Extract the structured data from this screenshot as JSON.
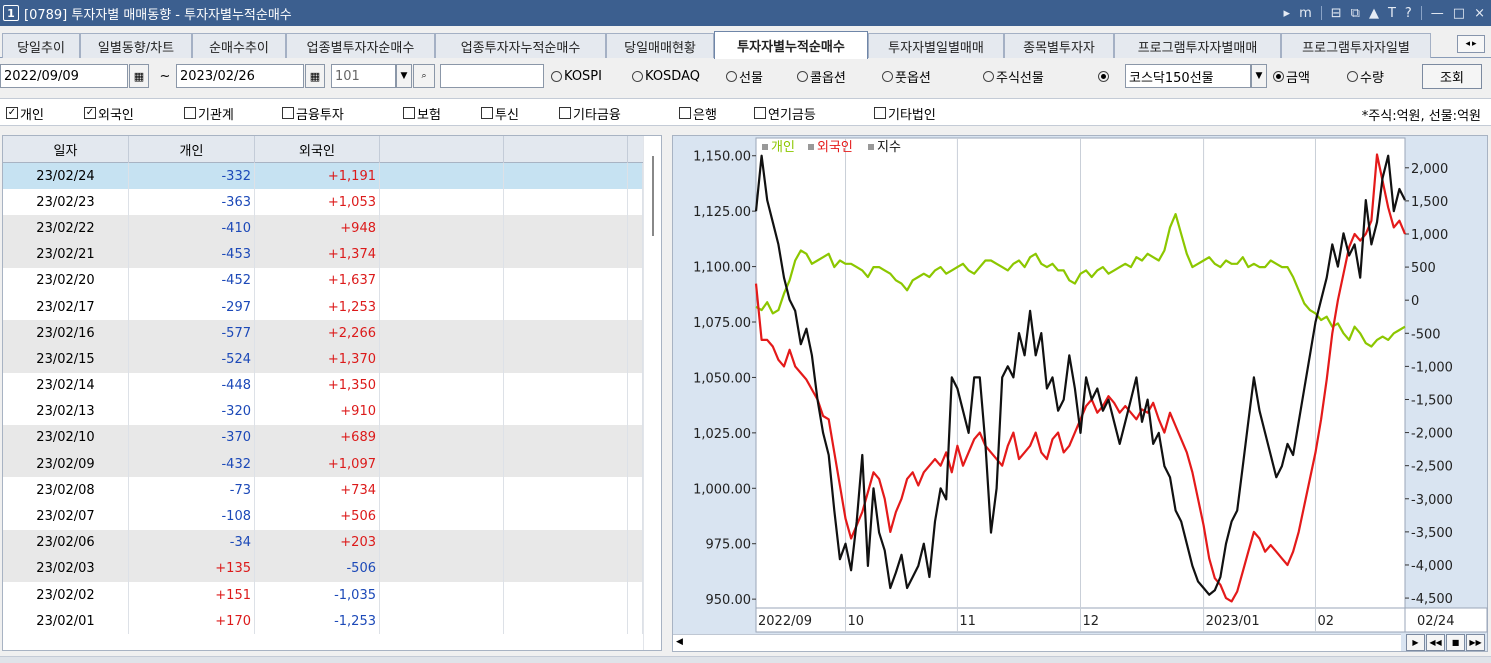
{
  "window": {
    "num": "1",
    "title": "[0789] 투자자별 매매동향 - 투자자별누적순매수",
    "controls": [
      "▸",
      "m",
      "⊟",
      "⧉",
      "▲",
      "T",
      "?",
      "—",
      "□",
      "×"
    ]
  },
  "tabs": [
    {
      "label": "당일추이"
    },
    {
      "label": "일별동향/차트"
    },
    {
      "label": "순매수추이"
    },
    {
      "label": "업종별투자자순매수"
    },
    {
      "label": "업종투자자누적순매수"
    },
    {
      "label": "당일매매현황"
    },
    {
      "label": "투자자별누적순매수",
      "active": true
    },
    {
      "label": "투자자별일별매매"
    },
    {
      "label": "종목별투자자"
    },
    {
      "label": "프로그램투자자별매매"
    },
    {
      "label": "프로그램투자자일별"
    }
  ],
  "tab_scroll": {
    "left": "◂",
    "right": "▸"
  },
  "filter": {
    "start_date": "2022/09/09",
    "tilde": "~",
    "end_date": "2023/02/26",
    "code": "101",
    "search_icon": "⌕",
    "empty_field": "",
    "radios": [
      {
        "label": "KOSPI",
        "on": false
      },
      {
        "label": "KOSDAQ",
        "on": false
      },
      {
        "label": "선물",
        "on": false
      },
      {
        "label": "콜옵션",
        "on": false
      },
      {
        "label": "풋옵션",
        "on": false
      },
      {
        "label": "주식선물",
        "on": false
      }
    ],
    "futures_radio_on": true,
    "futures_select": "코스닥150선물",
    "amount_radios": [
      {
        "label": "금액",
        "on": true
      },
      {
        "label": "수량",
        "on": false
      }
    ],
    "query_button": "조회"
  },
  "checks": [
    {
      "label": "개인",
      "checked": true
    },
    {
      "label": "외국인",
      "checked": true
    },
    {
      "label": "기관계",
      "checked": false
    },
    {
      "label": "금융투자",
      "checked": false
    },
    {
      "label": "보험",
      "checked": false
    },
    {
      "label": "투신",
      "checked": false
    },
    {
      "label": "기타금융",
      "checked": false
    },
    {
      "label": "은행",
      "checked": false
    },
    {
      "label": "연기금등",
      "checked": false
    },
    {
      "label": "기타법인",
      "checked": false
    }
  ],
  "unit_note": "*주식:억원, 선물:억원",
  "table": {
    "headers": [
      "일자",
      "개인",
      "외국인",
      "",
      ""
    ],
    "rows": [
      {
        "date": "23/02/24",
        "ind": "-332",
        "for": "+1,191"
      },
      {
        "date": "23/02/23",
        "ind": "-363",
        "for": "+1,053"
      },
      {
        "date": "23/02/22",
        "ind": "-410",
        "for": "+948"
      },
      {
        "date": "23/02/21",
        "ind": "-453",
        "for": "+1,374"
      },
      {
        "date": "23/02/20",
        "ind": "-452",
        "for": "+1,637"
      },
      {
        "date": "23/02/17",
        "ind": "-297",
        "for": "+1,253"
      },
      {
        "date": "23/02/16",
        "ind": "-577",
        "for": "+2,266"
      },
      {
        "date": "23/02/15",
        "ind": "-524",
        "for": "+1,370"
      },
      {
        "date": "23/02/14",
        "ind": "-448",
        "for": "+1,350"
      },
      {
        "date": "23/02/13",
        "ind": "-320",
        "for": "+910"
      },
      {
        "date": "23/02/10",
        "ind": "-370",
        "for": "+689"
      },
      {
        "date": "23/02/09",
        "ind": "-432",
        "for": "+1,097"
      },
      {
        "date": "23/02/08",
        "ind": "-73",
        "for": "+734"
      },
      {
        "date": "23/02/07",
        "ind": "-108",
        "for": "+506"
      },
      {
        "date": "23/02/06",
        "ind": "-34",
        "for": "+203"
      },
      {
        "date": "23/02/03",
        "ind": "+135",
        "for": "-506"
      },
      {
        "date": "23/02/02",
        "ind": "+151",
        "for": "-1,035"
      },
      {
        "date": "23/02/01",
        "ind": "+170",
        "for": "-1,253"
      }
    ]
  },
  "chart_data": {
    "type": "line",
    "legend": [
      {
        "name": "개인",
        "color": "#8cc700"
      },
      {
        "name": "외국인",
        "color": "#e41a1a"
      },
      {
        "name": "지수",
        "color": "#111111"
      }
    ],
    "left_axis_ticks": [
      "1,150.00",
      "1,125.00",
      "1,100.00",
      "1,075.00",
      "1,050.00",
      "1,025.00",
      "1,000.00",
      "975.00",
      "950.00"
    ],
    "left_axis_values": [
      1150,
      1125,
      1100,
      1075,
      1050,
      1025,
      1000,
      975,
      950
    ],
    "left_ylim": [
      946,
      1158
    ],
    "right_axis_ticks": [
      "2,000",
      "1,500",
      "1,000",
      "500",
      "0",
      "-500",
      "-1,000",
      "-1,500",
      "-2,000",
      "-2,500",
      "-3,000",
      "-3,500",
      "-4,000",
      "-4,500"
    ],
    "right_axis_values": [
      2000,
      1500,
      1000,
      500,
      0,
      -500,
      -1000,
      -1500,
      -2000,
      -2500,
      -3000,
      -3500,
      -4000,
      -4500
    ],
    "right_ylim": [
      -4650,
      2450
    ],
    "x_ticks": [
      {
        "label": "2022/09",
        "i": 0
      },
      {
        "label": "10",
        "i": 16
      },
      {
        "label": "11",
        "i": 36
      },
      {
        "label": "12",
        "i": 58
      },
      {
        "label": "2023/01",
        "i": 80
      },
      {
        "label": "02",
        "i": 100
      }
    ],
    "x_end_label": "02/24",
    "n_points": 117,
    "series": [
      {
        "name": "개인",
        "axis": "right",
        "values": [
          -100,
          -150,
          -30,
          -200,
          -150,
          100,
          300,
          600,
          750,
          700,
          550,
          600,
          650,
          700,
          500,
          600,
          550,
          550,
          500,
          450,
          350,
          500,
          500,
          450,
          400,
          300,
          250,
          150,
          300,
          350,
          400,
          350,
          450,
          500,
          400,
          450,
          500,
          550,
          450,
          400,
          500,
          600,
          600,
          550,
          500,
          450,
          550,
          600,
          500,
          650,
          700,
          550,
          500,
          550,
          450,
          450,
          300,
          250,
          400,
          450,
          350,
          450,
          500,
          400,
          450,
          500,
          550,
          500,
          650,
          600,
          700,
          650,
          600,
          750,
          1100,
          1300,
          1000,
          700,
          500,
          550,
          600,
          650,
          550,
          500,
          600,
          550,
          550,
          650,
          500,
          550,
          500,
          500,
          600,
          550,
          500,
          500,
          350,
          150,
          -50,
          -150,
          -200,
          -300,
          -250,
          -400,
          -350,
          -500,
          -600,
          -400,
          -500,
          -650,
          -700,
          -600,
          -550,
          -600,
          -500,
          -450,
          -400
        ]
      },
      {
        "name": "외국인",
        "axis": "right",
        "values": [
          250,
          -600,
          -600,
          -700,
          -900,
          -1000,
          -750,
          -1000,
          -1100,
          -1200,
          -1350,
          -1500,
          -1750,
          -1800,
          -2300,
          -2800,
          -3300,
          -3600,
          -3400,
          -3200,
          -2900,
          -2600,
          -2700,
          -3000,
          -3500,
          -3200,
          -3000,
          -2700,
          -2600,
          -2800,
          -2600,
          -2500,
          -2400,
          -2500,
          -2300,
          -2600,
          -2200,
          -2500,
          -2300,
          -2100,
          -2000,
          -2200,
          -2300,
          -2400,
          -2500,
          -2200,
          -2000,
          -2400,
          -2300,
          -2200,
          -2000,
          -2300,
          -2400,
          -2100,
          -2000,
          -2300,
          -2200,
          -2000,
          -1800,
          -1600,
          -1500,
          -1700,
          -1600,
          -1450,
          -1550,
          -1700,
          -1600,
          -1700,
          -1800,
          -1650,
          -1700,
          -1550,
          -1800,
          -2000,
          -1700,
          -1900,
          -2100,
          -2300,
          -2600,
          -3000,
          -3400,
          -3900,
          -4200,
          -4300,
          -4500,
          -4550,
          -4400,
          -4100,
          -3800,
          -3500,
          -3600,
          -3800,
          -3700,
          -3800,
          -3900,
          -4000,
          -3800,
          -3500,
          -3100,
          -2700,
          -2300,
          -1800,
          -1200,
          -500,
          0,
          400,
          800,
          1000,
          900,
          1000,
          1200,
          2200,
          1800,
          1400,
          1100,
          1200,
          1000
        ]
      },
      {
        "name": "지수",
        "axis": "left",
        "values": [
          1125,
          1150,
          1130,
          1120,
          1110,
          1095,
          1085,
          1080,
          1065,
          1072,
          1060,
          1040,
          1025,
          1015,
          990,
          968,
          975,
          963,
          985,
          1015,
          965,
          1000,
          980,
          972,
          955,
          962,
          970,
          955,
          960,
          965,
          975,
          960,
          985,
          1000,
          995,
          1050,
          1045,
          1035,
          1025,
          1050,
          1050,
          1020,
          980,
          1000,
          1050,
          1055,
          1050,
          1070,
          1060,
          1080,
          1060,
          1070,
          1045,
          1050,
          1035,
          1040,
          1060,
          1045,
          1025,
          1050,
          1040,
          1045,
          1035,
          1040,
          1030,
          1020,
          1030,
          1040,
          1050,
          1030,
          1040,
          1020,
          1025,
          1010,
          1005,
          990,
          985,
          975,
          965,
          958,
          955,
          952,
          954,
          960,
          975,
          985,
          990,
          1010,
          1030,
          1050,
          1035,
          1025,
          1015,
          1005,
          1010,
          1020,
          1015,
          1030,
          1045,
          1060,
          1075,
          1085,
          1095,
          1110,
          1100,
          1115,
          1105,
          1110,
          1095,
          1130,
          1110,
          1120,
          1140,
          1150,
          1125,
          1135,
          1130
        ]
      }
    ]
  }
}
